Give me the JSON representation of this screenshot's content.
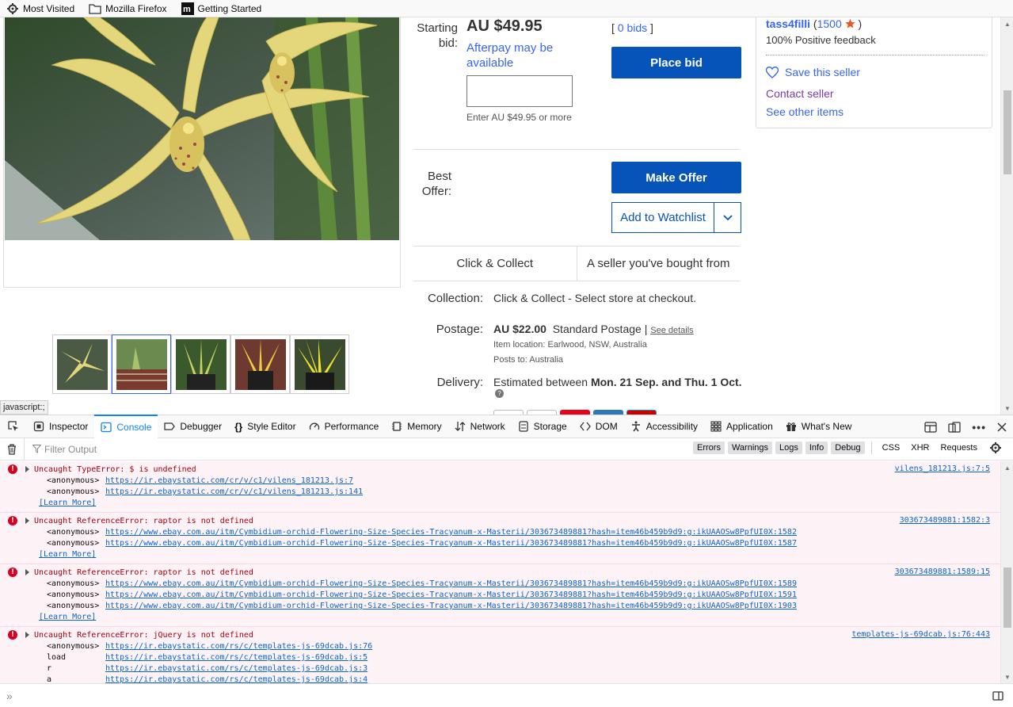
{
  "bookmarks": [
    {
      "label": "Most Visited",
      "icon": "gear-icon"
    },
    {
      "label": "Mozilla Firefox",
      "icon": "folder-icon"
    },
    {
      "label": "Getting Started",
      "icon": "mdn-icon"
    }
  ],
  "listing": {
    "starting_bid_label": "Starting bid:",
    "price": "AU $49.95",
    "afterpay": "Afterpay may be available",
    "enter_hint": "Enter AU $49.95 or more",
    "bids_open": "[ ",
    "bids": "0 bids",
    "bids_close": " ]",
    "place_bid": "Place bid",
    "best_offer_label": "Best Offer:",
    "make_offer": "Make Offer",
    "watchlist": "Add to Watchlist",
    "tag_click_collect": "Click & Collect",
    "tag_seller": "A seller you've bought from",
    "collection_label": "Collection:",
    "collection_value": "Click & Collect - Select store at checkout.",
    "postage_label": "Postage:",
    "postage_price": "AU $22.00",
    "postage_type": "Standard Postage",
    "postage_sep": " | ",
    "see_details": "See details",
    "item_location": "Item location:  Earlwood, NSW, Australia",
    "posts_to": "Posts to:  Australia",
    "delivery_label": "Delivery:",
    "delivery_prefix": "Estimated between ",
    "delivery_dates": "Mon. 21 Sep. and Thu. 1 Oct."
  },
  "seller": {
    "name": "tass4filli",
    "feedback_open": " (",
    "feedback_score": "1500",
    "feedback_close": " )",
    "positive": "100% Positive feedback",
    "save": "Save this seller",
    "contact": "Contact seller",
    "other": "See other items"
  },
  "status_text": "javascript:;",
  "devtools": {
    "tabs": [
      {
        "label": "Inspector",
        "icon": "inspector-icon"
      },
      {
        "label": "Console",
        "icon": "console-icon"
      },
      {
        "label": "Debugger",
        "icon": "debugger-icon"
      },
      {
        "label": "Style Editor",
        "icon": "style-editor-icon"
      },
      {
        "label": "Performance",
        "icon": "performance-icon"
      },
      {
        "label": "Memory",
        "icon": "memory-icon"
      },
      {
        "label": "Network",
        "icon": "network-icon"
      },
      {
        "label": "Storage",
        "icon": "storage-icon"
      },
      {
        "label": "DOM",
        "icon": "dom-icon"
      },
      {
        "label": "Accessibility",
        "icon": "accessibility-icon"
      },
      {
        "label": "Application",
        "icon": "application-icon"
      },
      {
        "label": "What's New",
        "icon": "gift-icon"
      }
    ],
    "active_tab": "Console",
    "filter_placeholder": "Filter Output",
    "levels": [
      "Errors",
      "Warnings",
      "Logs",
      "Info",
      "Debug"
    ],
    "extra_filters": [
      "CSS",
      "XHR",
      "Requests"
    ],
    "messages": [
      {
        "title": "Uncaught TypeError: $ is undefined",
        "source": "vilens_181213.js:7:5",
        "frames": [
          {
            "fn": "<anonymous>",
            "url": "https://ir.ebaystatic.com/cr/v/c1/vilens_181213.js:7"
          },
          {
            "fn": "<anonymous>",
            "url": "https://ir.ebaystatic.com/cr/v/c1/vilens_181213.js:141"
          }
        ],
        "learn_more": "[Learn More]"
      },
      {
        "title": "Uncaught ReferenceError: raptor is not defined",
        "source": "303673489881:1582:3",
        "frames": [
          {
            "fn": "<anonymous>",
            "url": "https://www.ebay.com.au/itm/Cymbidium-orchid-Flowering-Size-Species-Tracyanum-x-Masterii/303673489881?hash=item46b459b9d9:g:ikUAAOSw8PpfUI0X:1582"
          },
          {
            "fn": "<anonymous>",
            "url": "https://www.ebay.com.au/itm/Cymbidium-orchid-Flowering-Size-Species-Tracyanum-x-Masterii/303673489881?hash=item46b459b9d9:g:ikUAAOSw8PpfUI0X:1587"
          }
        ],
        "learn_more": "[Learn More]"
      },
      {
        "title": "Uncaught ReferenceError: raptor is not defined",
        "source": "303673489881:1589:15",
        "frames": [
          {
            "fn": "<anonymous>",
            "url": "https://www.ebay.com.au/itm/Cymbidium-orchid-Flowering-Size-Species-Tracyanum-x-Masterii/303673489881?hash=item46b459b9d9:g:ikUAAOSw8PpfUI0X:1589"
          },
          {
            "fn": "<anonymous>",
            "url": "https://www.ebay.com.au/itm/Cymbidium-orchid-Flowering-Size-Species-Tracyanum-x-Masterii/303673489881?hash=item46b459b9d9:g:ikUAAOSw8PpfUI0X:1591"
          },
          {
            "fn": "<anonymous>",
            "url": "https://www.ebay.com.au/itm/Cymbidium-orchid-Flowering-Size-Species-Tracyanum-x-Masterii/303673489881?hash=item46b459b9d9:g:ikUAAOSw8PpfUI0X:1903"
          }
        ],
        "learn_more": "[Learn More]"
      },
      {
        "title": "Uncaught ReferenceError: jQuery is not defined",
        "source": "templates-js-69dcab.js:76:443",
        "frames": [
          {
            "fn": "<anonymous>",
            "url": "https://ir.ebaystatic.com/rs/c/templates-js-69dcab.js:76"
          },
          {
            "fn": "load",
            "url": "https://ir.ebaystatic.com/rs/c/templates-js-69dcab.js:5"
          },
          {
            "fn": "r",
            "url": "https://ir.ebaystatic.com/rs/c/templates-js-69dcab.js:3"
          },
          {
            "fn": "a",
            "url": "https://ir.ebaystatic.com/rs/c/templates-js-69dcab.js:4"
          }
        ],
        "learn_more": ""
      }
    ]
  },
  "colors": {
    "primary_button": "#0654ba",
    "link": "#3665f3",
    "error_bg": "#fdf2f5",
    "error_text": "#a4000f"
  }
}
